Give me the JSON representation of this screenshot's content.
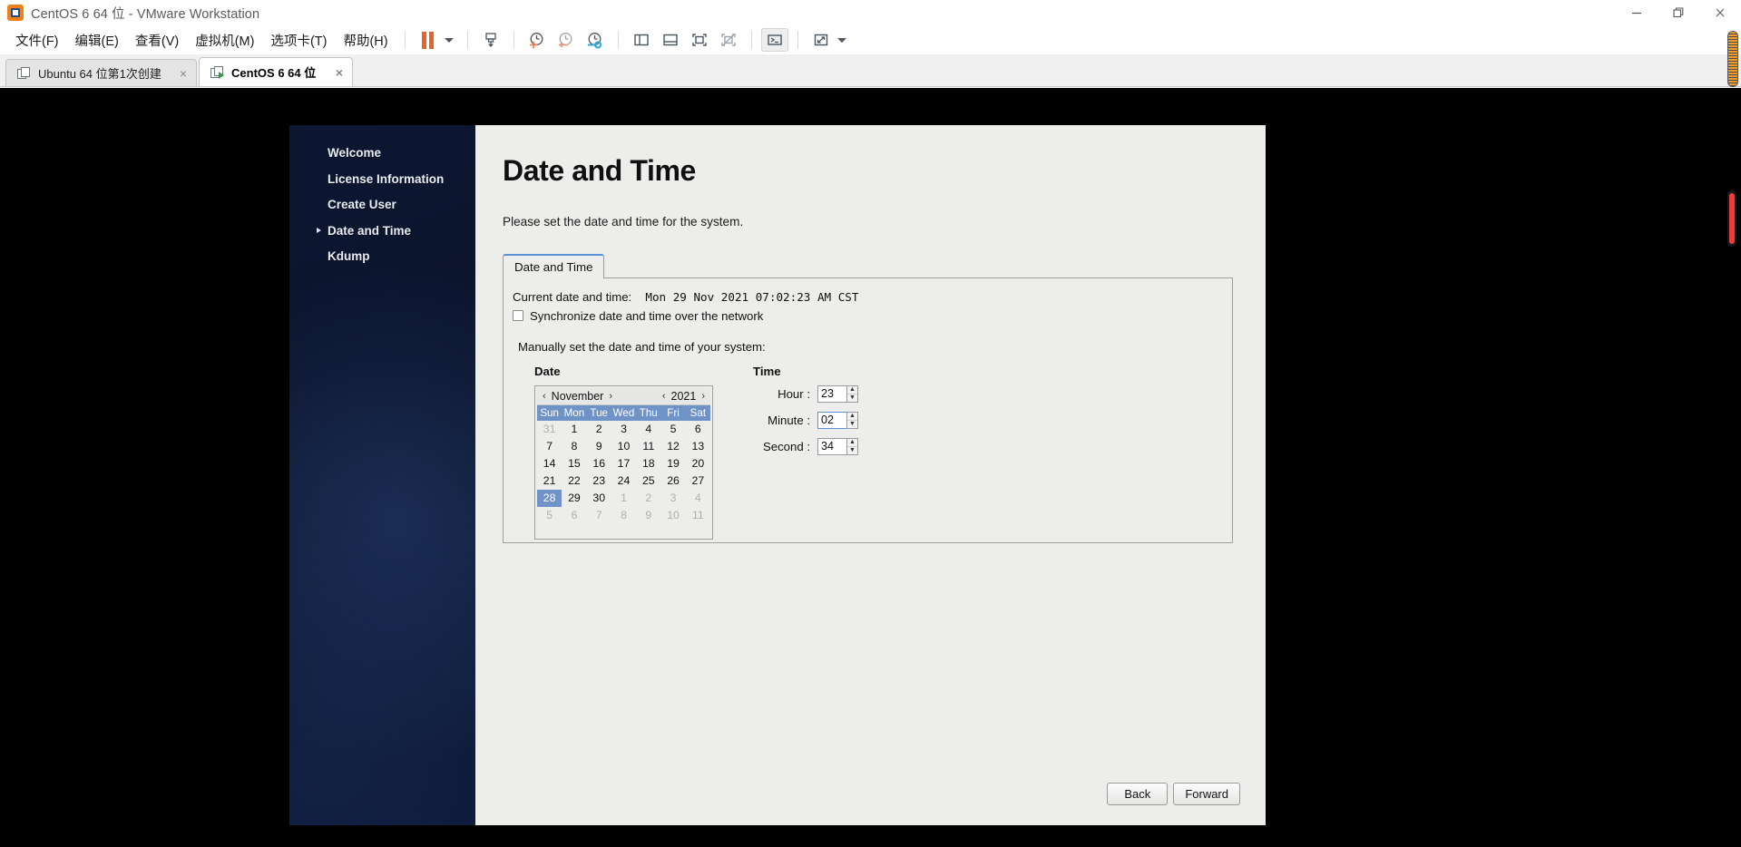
{
  "window": {
    "title": "CentOS 6 64 位 - VMware Workstation",
    "icon": "vmware-logo-icon",
    "controls": {
      "minimize": "minimize-icon",
      "restore": "restore-icon",
      "close": "close-icon"
    }
  },
  "menubar": {
    "items": [
      {
        "label": "文件(F)",
        "name": "menu-file"
      },
      {
        "label": "编辑(E)",
        "name": "menu-edit"
      },
      {
        "label": "查看(V)",
        "name": "menu-view"
      },
      {
        "label": "虚拟机(M)",
        "name": "menu-vm"
      },
      {
        "label": "选项卡(T)",
        "name": "menu-tabs"
      },
      {
        "label": "帮助(H)",
        "name": "menu-help"
      }
    ],
    "toolbar": [
      {
        "name": "pause-button",
        "icon": "pause-icon"
      },
      {
        "name": "pause-dropdown",
        "icon": "caret-down-icon"
      },
      {
        "name": "power-button",
        "icon": "suspend-icon"
      },
      {
        "name": "snapshot-take-button",
        "icon": "clock-plus-icon"
      },
      {
        "name": "snapshot-revert-button",
        "icon": "clock-back-icon"
      },
      {
        "name": "snapshot-manager-button",
        "icon": "clock-wrench-icon"
      },
      {
        "name": "show-library-button",
        "icon": "panel-left-icon"
      },
      {
        "name": "show-thumbnail-bar-button",
        "icon": "panel-bottom-icon"
      },
      {
        "name": "show-console-view-button",
        "icon": "console-view-icon"
      },
      {
        "name": "hide-console-view-button",
        "icon": "console-view-off-icon"
      },
      {
        "name": "terminal-button",
        "icon": "terminal-icon"
      },
      {
        "name": "fullscreen-button",
        "icon": "expand-icon"
      },
      {
        "name": "fullscreen-dropdown",
        "icon": "caret-down-icon"
      }
    ]
  },
  "tabs": [
    {
      "label": "Ubuntu 64 位第1次创建",
      "active": false,
      "close": "×"
    },
    {
      "label": "CentOS 6 64 位",
      "active": true,
      "close": "×"
    }
  ],
  "installer": {
    "sidebar": {
      "items": [
        {
          "label": "Welcome",
          "current": false
        },
        {
          "label": "License Information",
          "current": false
        },
        {
          "label": "Create User",
          "current": false
        },
        {
          "label": "Date and Time",
          "current": true
        },
        {
          "label": "Kdump",
          "current": false
        }
      ]
    },
    "page_title": "Date and Time",
    "page_description": "Please set the date and time for the system.",
    "tab_label": "Date and Time",
    "current_datetime_label": "Current date and time:",
    "current_datetime_value": "Mon 29 Nov 2021 07:02:23 AM CST",
    "sync_checkbox_label": "Synchronize date and time over the network",
    "sync_checked": false,
    "manual_label": "Manually set the date and time of your system:",
    "date": {
      "heading": "Date",
      "month": "November",
      "year": "2021",
      "prev_month_arrow": "‹",
      "next_month_arrow": "›",
      "prev_year_arrow": "‹",
      "next_year_arrow": "›",
      "weekdays": [
        "Sun",
        "Mon",
        "Tue",
        "Wed",
        "Thu",
        "Fri",
        "Sat"
      ],
      "weeks": [
        [
          {
            "d": "31",
            "dim": true
          },
          {
            "d": "1"
          },
          {
            "d": "2"
          },
          {
            "d": "3"
          },
          {
            "d": "4"
          },
          {
            "d": "5"
          },
          {
            "d": "6"
          }
        ],
        [
          {
            "d": "7"
          },
          {
            "d": "8"
          },
          {
            "d": "9"
          },
          {
            "d": "10"
          },
          {
            "d": "11"
          },
          {
            "d": "12"
          },
          {
            "d": "13"
          }
        ],
        [
          {
            "d": "14"
          },
          {
            "d": "15"
          },
          {
            "d": "16"
          },
          {
            "d": "17"
          },
          {
            "d": "18"
          },
          {
            "d": "19"
          },
          {
            "d": "20"
          }
        ],
        [
          {
            "d": "21"
          },
          {
            "d": "22"
          },
          {
            "d": "23"
          },
          {
            "d": "24"
          },
          {
            "d": "25"
          },
          {
            "d": "26"
          },
          {
            "d": "27"
          }
        ],
        [
          {
            "d": "28",
            "sel": true
          },
          {
            "d": "29"
          },
          {
            "d": "30"
          },
          {
            "d": "1",
            "dim": true
          },
          {
            "d": "2",
            "dim": true
          },
          {
            "d": "3",
            "dim": true
          },
          {
            "d": "4",
            "dim": true
          }
        ],
        [
          {
            "d": "5",
            "dim": true
          },
          {
            "d": "6",
            "dim": true
          },
          {
            "d": "7",
            "dim": true
          },
          {
            "d": "8",
            "dim": true
          },
          {
            "d": "9",
            "dim": true
          },
          {
            "d": "10",
            "dim": true
          },
          {
            "d": "11",
            "dim": true
          }
        ]
      ]
    },
    "time": {
      "heading": "Time",
      "hour_label": "Hour :",
      "hour_value": "23",
      "minute_label": "Minute :",
      "minute_value": "02",
      "second_label": "Second :",
      "second_value": "34",
      "focused_field": "minute"
    },
    "buttons": {
      "back": "Back",
      "forward": "Forward"
    }
  },
  "colors": {
    "accent_blue": "#6f93c6",
    "sidebar_navy": "#0c1630",
    "panel_gray": "#ededeb",
    "orange": "#e8622a",
    "red_scroll": "#f03b3b"
  }
}
